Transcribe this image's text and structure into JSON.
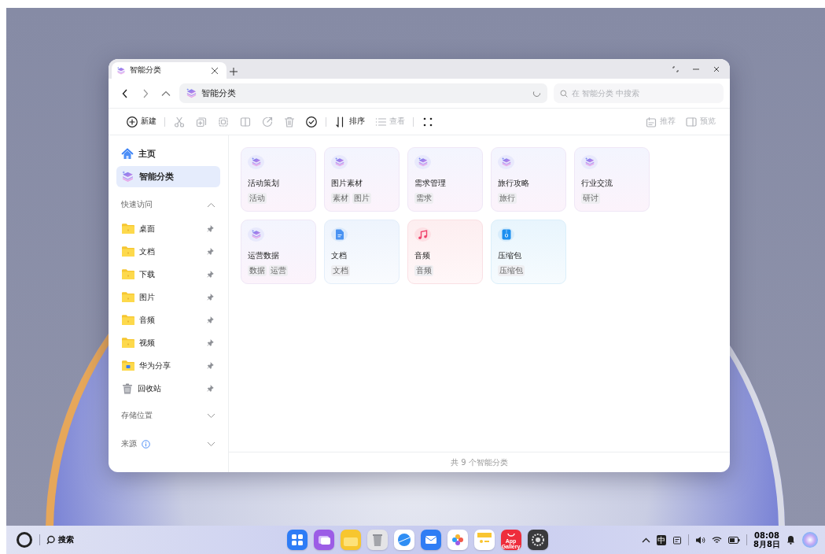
{
  "window": {
    "tab": {
      "title": "智能分类",
      "selected": true
    },
    "address": {
      "path": "智能分类"
    },
    "search": {
      "placeholder": "在 智能分类 中搜索"
    }
  },
  "toolbar": {
    "left": [
      {
        "kind": "new",
        "label": "新建",
        "disabled": false
      },
      {
        "kind": "cut",
        "disabled": true
      },
      {
        "kind": "copy",
        "disabled": true
      },
      {
        "kind": "paste",
        "disabled": true
      },
      {
        "kind": "rename",
        "disabled": true
      },
      {
        "kind": "share",
        "disabled": true
      },
      {
        "kind": "delete",
        "disabled": true
      },
      {
        "kind": "select",
        "disabled": false
      },
      {
        "kind": "sort",
        "label": "排序",
        "disabled": false
      },
      {
        "kind": "view",
        "label": "查看",
        "disabled": true
      },
      {
        "kind": "grid",
        "disabled": false
      }
    ],
    "right": [
      {
        "kind": "recommend",
        "label": "推荐",
        "disabled": true
      },
      {
        "kind": "preview",
        "label": "预览",
        "disabled": true
      }
    ]
  },
  "sidebar": {
    "places": [
      {
        "kind": "home",
        "label": "主页",
        "selected": false
      },
      {
        "kind": "smart",
        "label": "智能分类",
        "selected": true
      }
    ],
    "sections": [
      {
        "title": "快速访问",
        "expanded": true,
        "items": [
          {
            "kind": "folder",
            "label": "桌面",
            "pinned": true
          },
          {
            "kind": "folder",
            "label": "文档",
            "pinned": true
          },
          {
            "kind": "folder",
            "label": "下载",
            "pinned": true
          },
          {
            "kind": "folder",
            "label": "图片",
            "pinned": true
          },
          {
            "kind": "folder",
            "label": "音频",
            "pinned": true
          },
          {
            "kind": "folder",
            "label": "视频",
            "pinned": true
          },
          {
            "kind": "share",
            "label": "华为分享",
            "pinned": true
          },
          {
            "kind": "trash",
            "label": "回收站",
            "pinned": true
          }
        ]
      },
      {
        "title": "存储位置",
        "expanded": false
      },
      {
        "title": "来源",
        "expanded": false,
        "info": true
      }
    ]
  },
  "categories": [
    {
      "kind": "smart",
      "title": "活动策划",
      "tags": [
        "活动"
      ]
    },
    {
      "kind": "smart",
      "title": "图片素材",
      "tags": [
        "素材",
        "图片"
      ]
    },
    {
      "kind": "smart",
      "title": "需求管理",
      "tags": [
        "需求"
      ]
    },
    {
      "kind": "smart",
      "title": "旅行攻略",
      "tags": [
        "旅行"
      ]
    },
    {
      "kind": "smart",
      "title": "行业交流",
      "tags": [
        "研讨"
      ]
    },
    {
      "kind": "smart",
      "title": "运营数据",
      "tags": [
        "数据",
        "运营"
      ]
    },
    {
      "kind": "document",
      "title": "文档",
      "tags": [
        "文档"
      ]
    },
    {
      "kind": "audio",
      "title": "音频",
      "tags": [
        "音频"
      ]
    },
    {
      "kind": "archive",
      "title": "压缩包",
      "tags": [
        "压缩包"
      ]
    }
  ],
  "status_bar": "共 9 个智能分类",
  "taskbar": {
    "search": "搜索",
    "dock": [
      {
        "kind": "launcher"
      },
      {
        "kind": "multitask"
      },
      {
        "kind": "files"
      },
      {
        "kind": "trash"
      },
      {
        "kind": "browser"
      },
      {
        "kind": "mail"
      },
      {
        "kind": "photos"
      },
      {
        "kind": "notes"
      },
      {
        "kind": "store",
        "label": "App Gallery"
      },
      {
        "kind": "settings"
      }
    ],
    "input_method": "中",
    "time": "08:08",
    "date": "8月8日"
  }
}
